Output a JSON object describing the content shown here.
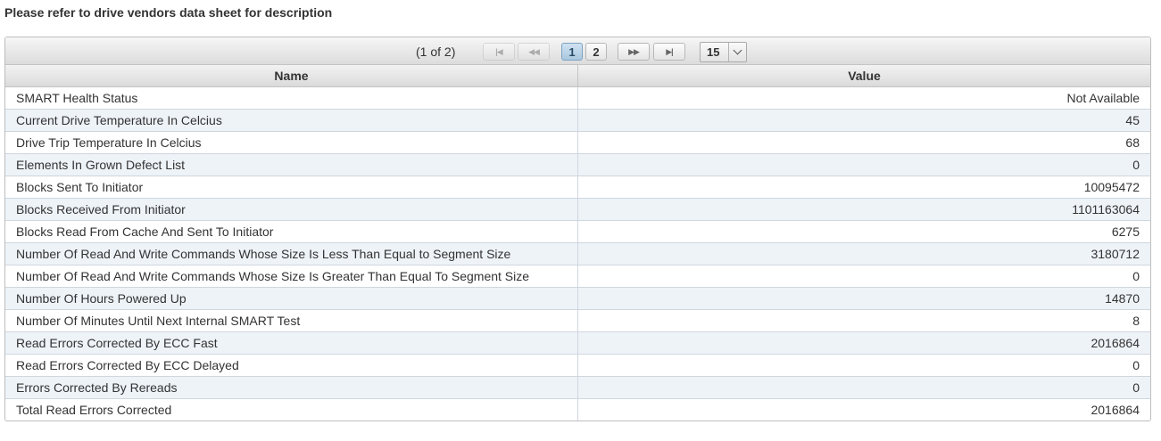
{
  "note": "Please refer to drive vendors data sheet for description",
  "pager": {
    "page_info": "(1 of 2)",
    "first_icon": "first-page-icon",
    "prev_icon": "previous-page-icon",
    "next_icon": "next-page-icon",
    "last_icon": "last-page-icon",
    "pages": [
      "1",
      "2"
    ],
    "current_page": "1",
    "rows_per_page": "15"
  },
  "table": {
    "headers": [
      "Name",
      "Value"
    ],
    "rows": [
      {
        "name": "SMART Health Status",
        "value": "Not Available"
      },
      {
        "name": "Current Drive Temperature In Celcius",
        "value": "45"
      },
      {
        "name": "Drive Trip Temperature In Celcius",
        "value": "68"
      },
      {
        "name": "Elements In Grown Defect List",
        "value": "0"
      },
      {
        "name": "Blocks Sent To Initiator",
        "value": "10095472"
      },
      {
        "name": "Blocks Received From Initiator",
        "value": "1101163064"
      },
      {
        "name": "Blocks Read From Cache And Sent To Initiator",
        "value": "6275"
      },
      {
        "name": "Number Of Read And Write Commands Whose Size Is Less Than Equal to Segment Size",
        "value": "3180712"
      },
      {
        "name": "Number Of Read And Write Commands Whose Size Is Greater Than Equal To Segment Size",
        "value": "0"
      },
      {
        "name": "Number Of Hours Powered Up",
        "value": "14870"
      },
      {
        "name": "Number Of Minutes Until Next Internal SMART Test",
        "value": "8"
      },
      {
        "name": "Read Errors Corrected By ECC Fast",
        "value": "2016864"
      },
      {
        "name": "Read Errors Corrected By ECC Delayed",
        "value": "0"
      },
      {
        "name": "Errors Corrected By Rereads",
        "value": "0"
      },
      {
        "name": "Total Read Errors Corrected",
        "value": "2016864"
      }
    ]
  },
  "colors": {
    "alt_row": "#eef3f8",
    "active_page": "#a9c8e0"
  }
}
